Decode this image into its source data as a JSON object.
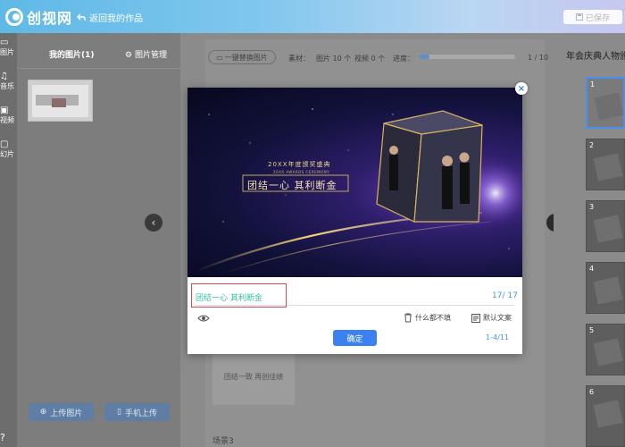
{
  "header": {
    "logo_text": "创视网",
    "back_label": "返回我的作品",
    "saved_label": "已保存"
  },
  "rail": {
    "items": [
      {
        "icon": "image-icon",
        "label": "图片"
      },
      {
        "icon": "music-icon",
        "label": "音乐"
      },
      {
        "icon": "video-icon",
        "label": "视频"
      },
      {
        "icon": "slide-icon",
        "label": "幻片"
      }
    ]
  },
  "image_panel": {
    "tab_my": "我的图片(1)",
    "tab_manage": "图片管理",
    "upload_label": "上传图片",
    "phone_upload_label": "手机上传"
  },
  "toolbar": {
    "replace_label": "一键替换图片",
    "materials_label": "素材：",
    "images_label": "图片 10 个",
    "videos_label": "视频 0 个",
    "progress_label": "进度：",
    "progress_value": 0.1,
    "page_count": "1 / 10"
  },
  "stage": {
    "scene_card_text": "团结一致 再创佳绩",
    "scene_label": "场景3"
  },
  "right_panel": {
    "title": "年会庆典人物颁",
    "slides": [
      "1",
      "2",
      "3",
      "4",
      "5",
      "6"
    ]
  },
  "modal": {
    "preview_small_title": "20XX年度颁奖盛典",
    "preview_small_en": "20XX AWARDS CEREMONY",
    "preview_main_title": "团结一心 其利断金",
    "caption_value": "团结一心 其利断金",
    "char_count": "17/ 17",
    "none_fill_label": "什么都不填",
    "default_text_label": "默认文案",
    "confirm_label": "确定",
    "page_index": "1-4/11"
  },
  "colors": {
    "accent": "#3b82f0",
    "caption_text": "#35c2a4",
    "highlight_border": "#d84a4a"
  }
}
